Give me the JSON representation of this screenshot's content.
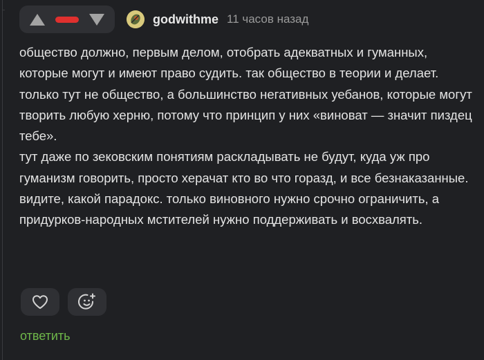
{
  "comment": {
    "author": "godwithme",
    "time_ago": "11 часов назад",
    "paragraphs": [
      "общество должно, первым делом, отобрать адекватных и гуманных, которые могут и имеют право судить. так общество в теории и делает. только тут не общество, а большинство негативных уебанов, которые могут творить любую херню, потому что принцип у них «виноват — значит пиздец тебе».",
      "тут даже по зековским понятиям раскладывать не будут, куда уж про гуманизм говорить, просто херачат кто во что горазд, и все безнаказанные. видите, какой парадокс. только виновного нужно срочно ограничить, а придурков-народных мстителей нужно поддерживать и восхвалять."
    ],
    "reply_label": "ответить"
  },
  "icons": {
    "upvote": "triangle-up-icon",
    "downvote": "triangle-down-icon",
    "rating": "negative-rating-bar",
    "like": "heart-icon",
    "emoji": "add-emoji-icon"
  },
  "colors": {
    "background": "#1f2023",
    "panel": "#2f3034",
    "rating_negative": "#e0302e",
    "reply_link": "#6fb84a",
    "muted_text": "#9a9a9a"
  }
}
